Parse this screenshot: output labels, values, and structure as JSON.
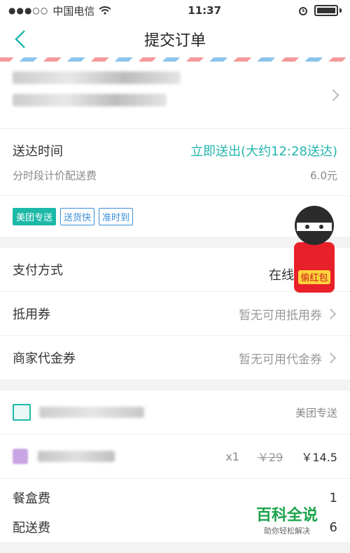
{
  "status": {
    "carrier": "中国电信",
    "time": "11:37",
    "signal_dots": "●●●○○"
  },
  "nav": {
    "title": "提交订单"
  },
  "delivery": {
    "label": "送达时间",
    "value": "立即送出(大约12:28送达)",
    "fee_label": "分时段计价配送费",
    "fee_value": "6.0元"
  },
  "tags": [
    "美团专送",
    "送货快",
    "准时到"
  ],
  "payment": {
    "label": "支付方式",
    "value": "在线支"
  },
  "coupon": {
    "label": "抵用券",
    "value": "暂无可用抵用券"
  },
  "voucher": {
    "label": "商家代金券",
    "value": "暂无可用代金券"
  },
  "shop": {
    "delivery": "美团专送"
  },
  "item": {
    "qty": "x1",
    "orig_price": "￥29",
    "price": "￥14.5"
  },
  "fees": [
    {
      "label": "餐盒费",
      "value": "1"
    },
    {
      "label": "配送费",
      "value": "6"
    }
  ],
  "badge": {
    "text": "偷红包"
  },
  "watermark": {
    "title": "百科全说",
    "subtitle": "助你轻松解决"
  },
  "colors": {
    "accent": "#22b6ae",
    "tag_blue": "#3b8fd8"
  }
}
